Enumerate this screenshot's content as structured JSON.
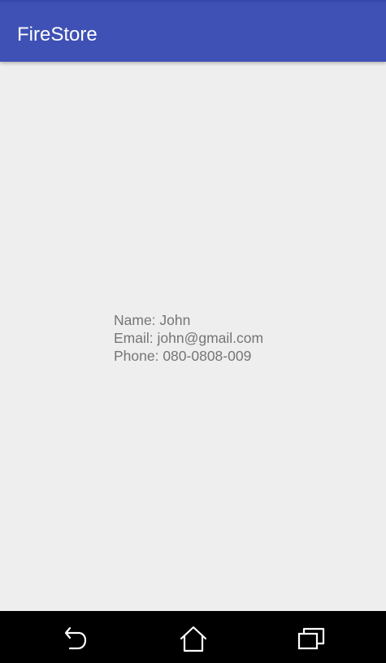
{
  "app_bar": {
    "title": "FireStore",
    "color": "#3f51b5"
  },
  "profile": {
    "name": "Name: John",
    "email": "Email: john@gmail.com",
    "phone": "Phone: 080-0808-009"
  },
  "nav_bar": {
    "back_icon": "back-icon",
    "home_icon": "home-icon",
    "recents_icon": "recents-icon"
  }
}
